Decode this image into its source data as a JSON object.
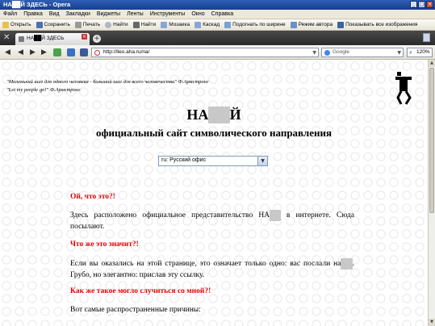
{
  "window": {
    "title": "НА██Й ЗДЕСЬ - Opera"
  },
  "menu": [
    "Файл",
    "Правка",
    "Вид",
    "Закладки",
    "Виджеты",
    "Ленты",
    "Инструменты",
    "Окно",
    "Справка"
  ],
  "toolbar": [
    "Открыть",
    "Сохранить",
    "Печать",
    "Найти",
    "Найти",
    "Мозаика",
    "Каскад",
    "Подогнать по ширине",
    "Режим автора",
    "Показывать все изображения"
  ],
  "tab": {
    "label": "НА██Й ЗДЕСЬ"
  },
  "address": {
    "url": "http://lleo.aha.ru/na/",
    "search_placeholder": "Google",
    "zoom": "120%"
  },
  "page": {
    "quote1": "\"Маленький шаг для одного человека - большой шаг для всего человечества\" Ф.Армстронг",
    "quote2": "\"Let my people go!\" Ф.Армстронг",
    "title_prefix": "НА",
    "title_suffix": "Й",
    "subtitle": "официальный сайт символического направления",
    "select_value": "ru: Русский офис",
    "h1": "Ой, что это?!",
    "p1_a": "Здесь расположено официальное представительство НА",
    "p1_b": " в интернете. Сюда посылают.",
    "h2": "Что же это значит?!",
    "p2_a": "Если вы оказались на этой странице, это означает только одно: вас послали на",
    "p2_b": ". Грубо, но элегантно: прислав эту ссылку.",
    "h3": "Как же такое могло случиться со мной?!",
    "p3": "Вот самые распространенные причины:"
  }
}
